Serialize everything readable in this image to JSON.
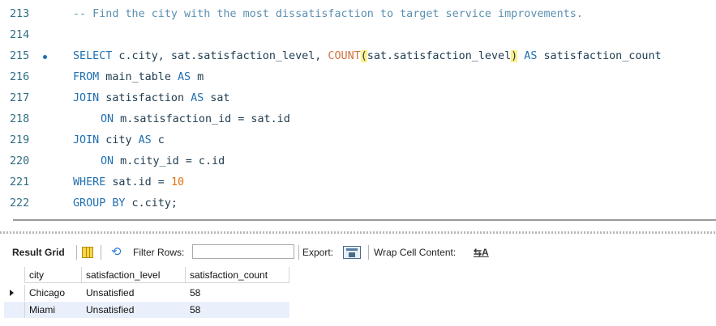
{
  "editor": {
    "lines": [
      {
        "num": "213",
        "comment": "-- Find the city with the most dissatisfaction to target service improvements."
      },
      {
        "num": "214"
      },
      {
        "num": "215",
        "kw1": "SELECT",
        "t1": " c.city, sat.satisfaction_level, ",
        "fn": "COUNT",
        "paren_open": "(",
        "t2": "sat.satisfaction_level",
        "paren_close": ")",
        "kw2": " AS",
        "t3": " satisfaction_count"
      },
      {
        "num": "216",
        "kw1": "FROM",
        "t1": " main_table ",
        "kw2": "AS",
        "t2": " m"
      },
      {
        "num": "217",
        "kw1": "JOIN",
        "t1": " satisfaction ",
        "kw2": "AS",
        "t2": " sat"
      },
      {
        "num": "218",
        "kw1": "ON",
        "t1": " m.satisfaction_id = sat.id"
      },
      {
        "num": "219",
        "kw1": "JOIN",
        "t1": " city ",
        "kw2": "AS",
        "t2": " c"
      },
      {
        "num": "220",
        "kw1": "ON",
        "t1": " m.city_id = c.id"
      },
      {
        "num": "221",
        "kw1": "WHERE",
        "t1": " sat.id = ",
        "val": "10"
      },
      {
        "num": "222",
        "kw1": "GROUP BY",
        "t1": " c.city;"
      }
    ]
  },
  "toolbar": {
    "result_grid_label": "Result Grid",
    "filter_rows_label": "Filter Rows:",
    "filter_rows_value": "",
    "export_label": "Export:",
    "wrap_label": "Wrap Cell Content:",
    "grid_icon": "grid-view-icon",
    "refresh_icon": "refresh-arrows-icon",
    "export_icon": "export-file-icon",
    "wrap_icon": "wrap-text-icon"
  },
  "grid": {
    "columns": [
      "city",
      "satisfaction_level",
      "satisfaction_count"
    ],
    "rows": [
      [
        "Chicago",
        "Unsatisfied",
        "58"
      ],
      [
        "Miami",
        "Unsatisfied",
        "58"
      ]
    ]
  },
  "colors": {
    "keyword": "#1f6fb2",
    "function": "#d4713a",
    "number": "#e2740d",
    "comment": "#5a8fb0",
    "paren_highlight": "#fff08a",
    "alt_row": "#e9f0fb"
  }
}
